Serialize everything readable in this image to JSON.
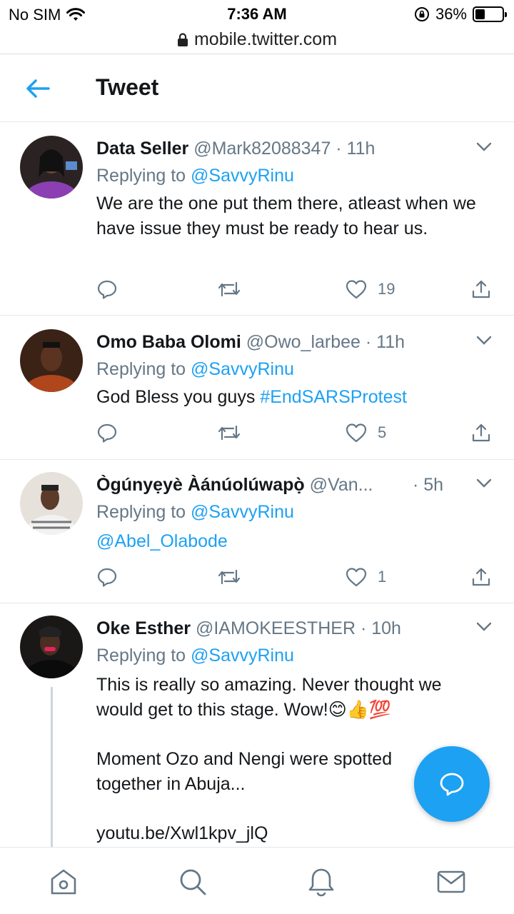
{
  "status_bar": {
    "carrier": "No SIM",
    "time": "7:36 AM",
    "battery": "36%",
    "battery_level": 0.36
  },
  "browser": {
    "url": "mobile.twitter.com"
  },
  "header": {
    "title": "Tweet"
  },
  "tweets": [
    {
      "name": "Data Seller",
      "meta": "@Mark82088347 · 11h",
      "replying_prefix": "Replying to ",
      "replying_handle": "@SavvyRinu",
      "text": "We are the one put them there, atleast when we have issue they must be ready to hear us.",
      "likes": "19"
    },
    {
      "name": "Omo Baba Olomi",
      "meta": "@Owo_larbee · 11h",
      "replying_prefix": "Replying to ",
      "replying_handle": "@SavvyRinu",
      "text": "God Bless you guys ",
      "hashtag": "#EndSARSProtest",
      "likes": "5"
    },
    {
      "name": "Ògúnyẹyè Àánúolúwapọ̀",
      "meta": "@Van...",
      "time": "· 5h",
      "replying_prefix": "Replying to ",
      "replying_handle": "@SavvyRinu",
      "mention": "@Abel_Olabode",
      "likes": "1"
    },
    {
      "name": "Oke Esther",
      "meta": "@IAMOKEESTHER · 10h",
      "replying_prefix": "Replying to ",
      "replying_handle": "@SavvyRinu",
      "text": "This is really so amazing. Never thought we would get to this stage. Wow!😊👍💯",
      "text2_line1": "Moment Ozo and Nengi were spotted",
      "text2_line2": "together in Abuja...",
      "link": "youtu.be/Xwl1kpv_jlQ"
    }
  ],
  "icons": {
    "back": "back-arrow-icon",
    "chevron": "chevron-down-icon",
    "reply": "reply-icon",
    "retweet": "retweet-icon",
    "like": "heart-icon",
    "share": "share-icon",
    "compose": "compose-reply-icon",
    "home": "home-icon",
    "search": "search-icon",
    "notifications": "bell-icon",
    "messages": "mail-icon"
  },
  "colors": {
    "accent": "#1da1f2",
    "secondary_text": "#657786",
    "divider": "#e1e8ed"
  }
}
